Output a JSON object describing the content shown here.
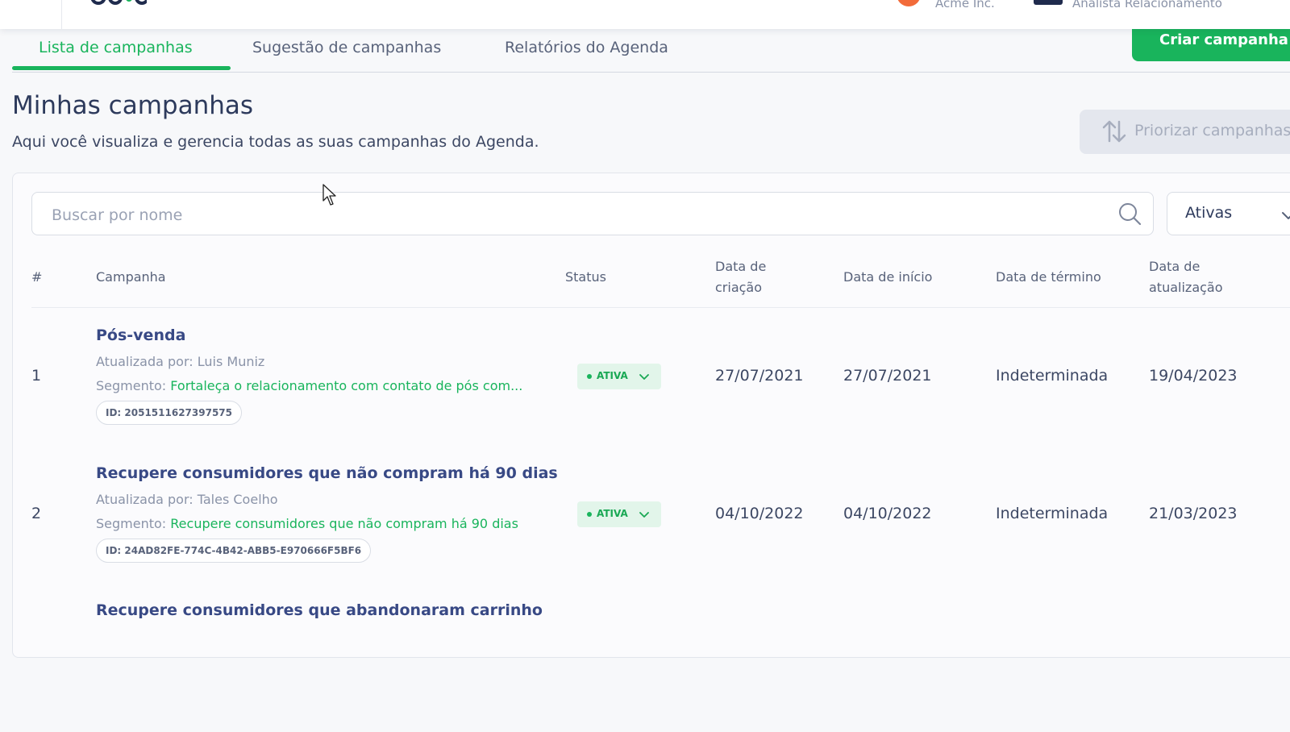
{
  "header": {
    "company_name": "Acme Inc.",
    "user_role": "Analista Relacionamento"
  },
  "tabs": [
    {
      "label": "Lista de campanhas",
      "active": true
    },
    {
      "label": "Sugestão de campanhas",
      "active": false
    },
    {
      "label": "Relatórios do Agenda",
      "active": false
    }
  ],
  "actions": {
    "create_label": "Criar campanha",
    "prioritize_label": "Priorizar campanhas"
  },
  "page": {
    "title": "Minhas campanhas",
    "subtitle": "Aqui você visualiza e gerencia todas as suas campanhas do Agenda."
  },
  "search": {
    "placeholder": "Buscar por nome",
    "value": ""
  },
  "filter": {
    "selected": "Ativas"
  },
  "table": {
    "headers": {
      "num": "#",
      "campaign": "Campanha",
      "status": "Status",
      "created_l1": "Data de",
      "created_l2": "criação",
      "start": "Data de início",
      "end": "Data de término",
      "updated_l1": "Data de",
      "updated_l2": "atualização"
    },
    "segment_prefix": "Segmento:",
    "rows": [
      {
        "num": "1",
        "name": "Pós-venda",
        "updated_by": "Atualizada por: Luis Muniz",
        "segment": "Fortaleça o relacionamento com contato de pós com...",
        "id": "ID: 2051511627397575",
        "status": "ATIVA",
        "created": "27/07/2021",
        "start": "27/07/2021",
        "end": "Indeterminada",
        "updated": "19/04/2023"
      },
      {
        "num": "2",
        "name": "Recupere consumidores que não compram há 90 dias",
        "updated_by": "Atualizada por: Tales Coelho",
        "segment": "Recupere consumidores que não compram há 90 dias",
        "id": "ID: 24AD82FE-774C-4B42-ABB5-E970666F5BF6",
        "status": "ATIVA",
        "created": "04/10/2022",
        "start": "04/10/2022",
        "end": "Indeterminada",
        "updated": "21/03/2023"
      },
      {
        "num": "",
        "name": "Recupere consumidores que abandonaram carrinho"
      }
    ]
  },
  "colors": {
    "brand_green": "#19b45c",
    "title_navy": "#384985",
    "text_dark": "#2d3a5c"
  }
}
